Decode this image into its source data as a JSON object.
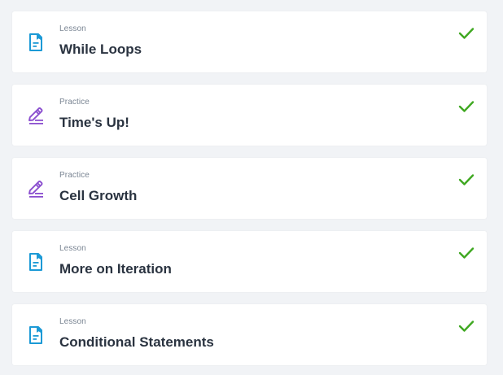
{
  "colors": {
    "page_background": "#f1f3f6",
    "card_background": "#ffffff",
    "lesson_icon": "#1c9ad6",
    "practice_icon": "#8b4fcf",
    "check": "#3fa821",
    "title_text": "#2a3340",
    "kind_text": "#7a8593"
  },
  "items": [
    {
      "kind": "Lesson",
      "title": "While Loops",
      "icon": "lesson-doc-icon",
      "completed": true
    },
    {
      "kind": "Practice",
      "title": "Time's Up!",
      "icon": "practice-pencil-icon",
      "completed": true
    },
    {
      "kind": "Practice",
      "title": "Cell Growth",
      "icon": "practice-pencil-icon",
      "completed": true
    },
    {
      "kind": "Lesson",
      "title": "More on Iteration",
      "icon": "lesson-doc-icon",
      "completed": true
    },
    {
      "kind": "Lesson",
      "title": "Conditional Statements",
      "icon": "lesson-doc-icon",
      "completed": true
    }
  ]
}
